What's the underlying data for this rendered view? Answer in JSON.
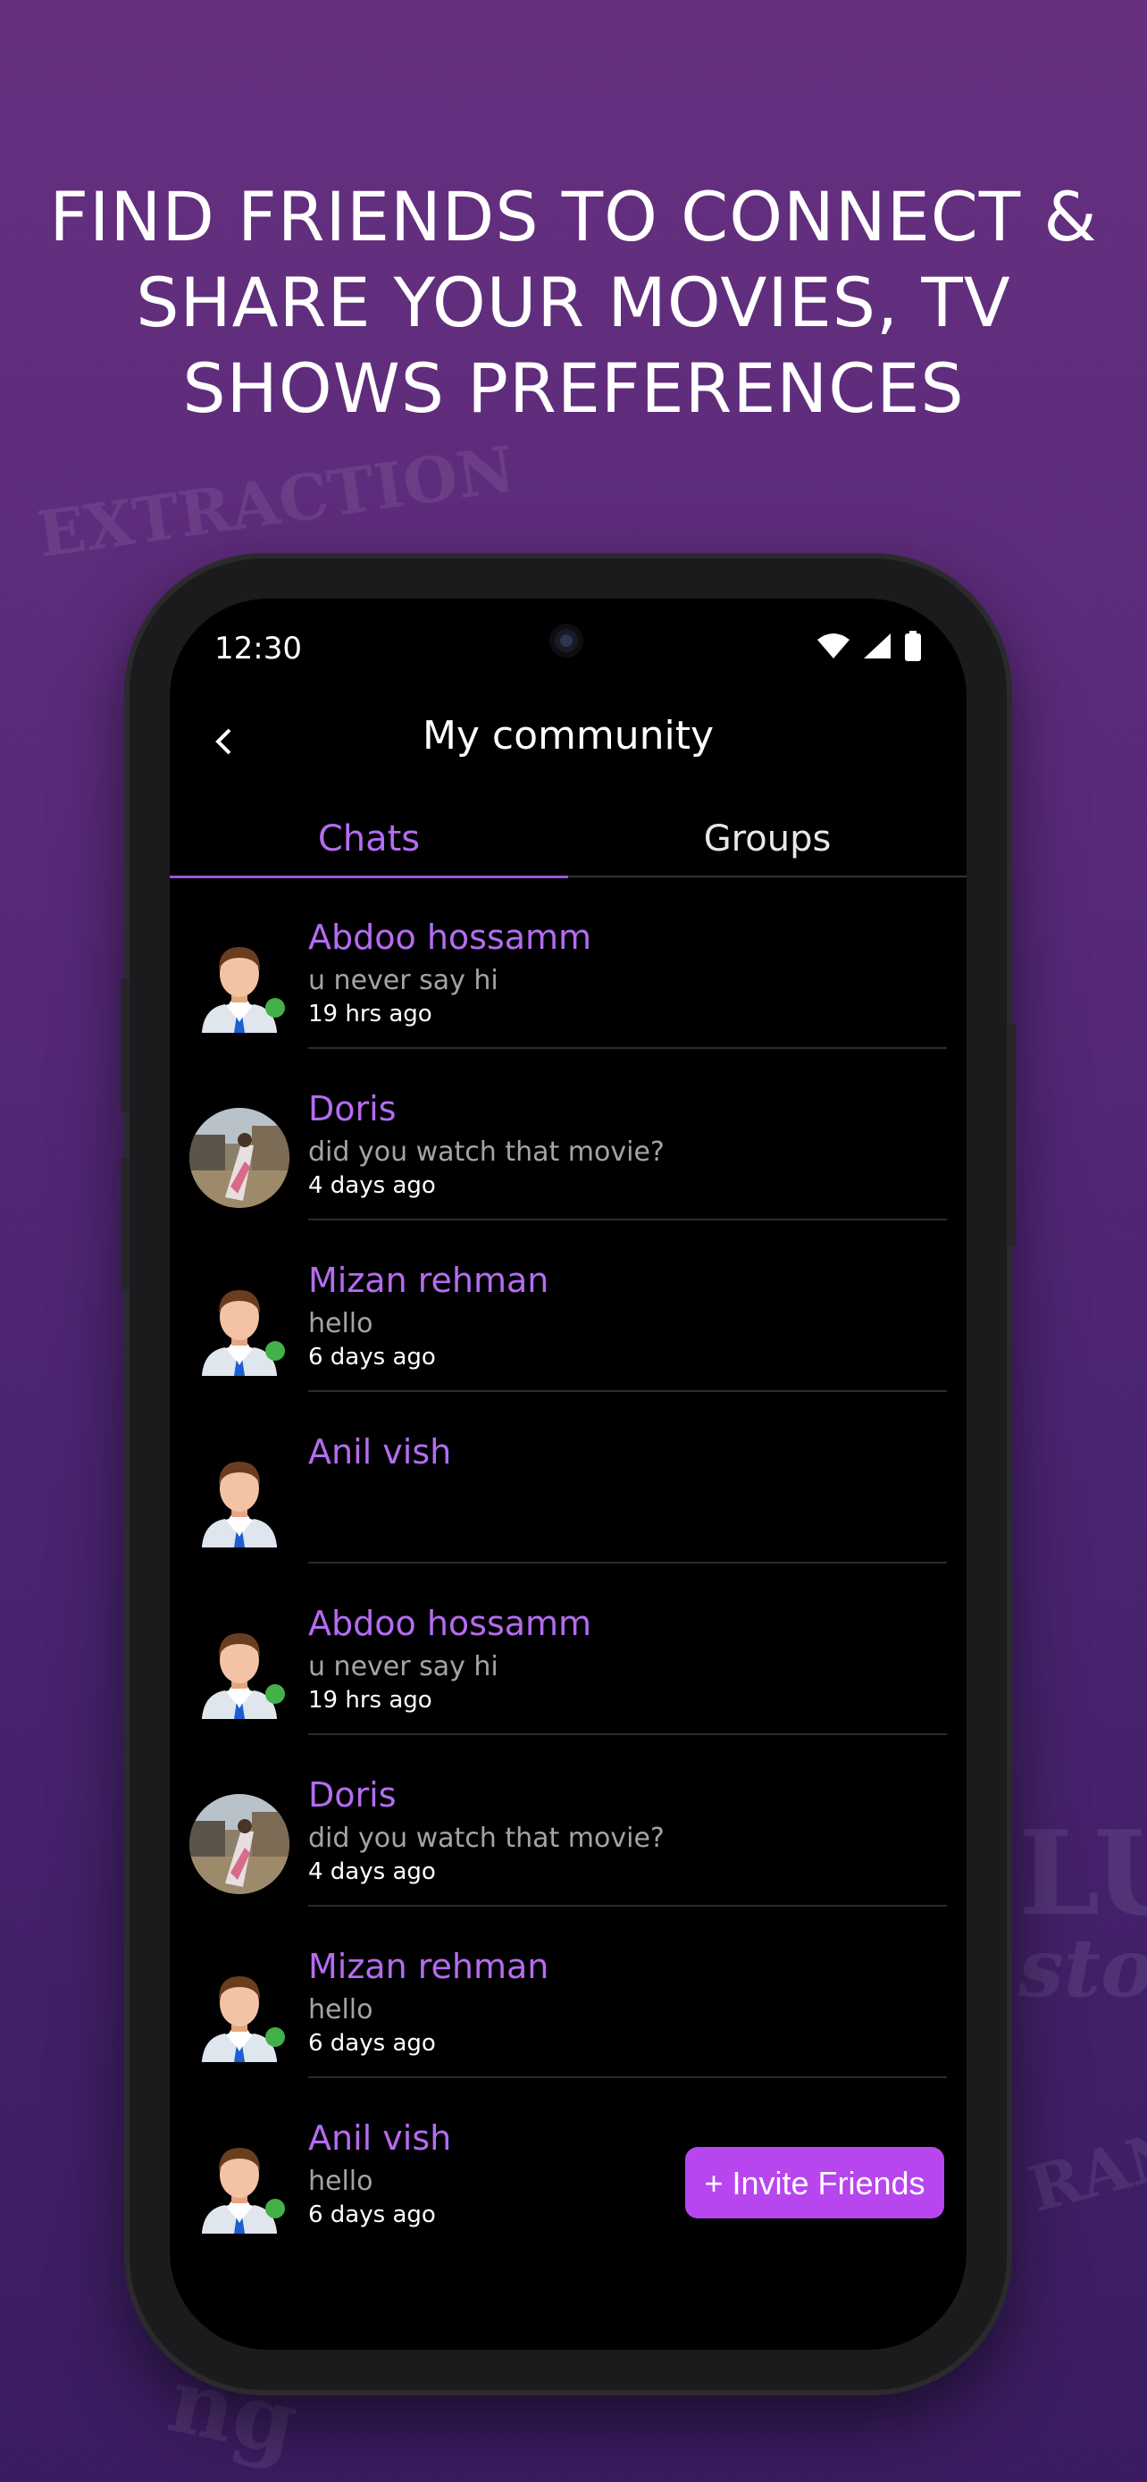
{
  "headline": {
    "line1": "FIND FRIENDS TO CONNECT &",
    "line2": "SHARE YOUR MOVIES, TV",
    "line3": "SHOWS PREFERENCES"
  },
  "background_posters": [
    "EXTRACTION",
    "LU",
    "stor",
    "RANG",
    "ng"
  ],
  "status_bar": {
    "time": "12:30",
    "icons": [
      "wifi-icon",
      "signal-icon",
      "battery-icon"
    ]
  },
  "header": {
    "title": "My community",
    "back_icon": "chevron-left-icon"
  },
  "tabs": [
    {
      "label": "Chats",
      "active": true
    },
    {
      "label": "Groups",
      "active": false
    }
  ],
  "chats": [
    {
      "name": "Abdoo hossamm",
      "message": "u never say hi",
      "time": "19 hrs ago",
      "avatar": "default-avatar",
      "online": true
    },
    {
      "name": "Doris",
      "message": "did you watch that movie?",
      "time": "4 days ago",
      "avatar": "photo",
      "online": false
    },
    {
      "name": "Mizan rehman",
      "message": "hello",
      "time": "6 days ago",
      "avatar": "default-avatar",
      "online": true
    },
    {
      "name": "Anil vish",
      "message": "",
      "time": "",
      "avatar": "default-avatar",
      "online": false
    },
    {
      "name": "Abdoo hossamm",
      "message": "u never say hi",
      "time": "19 hrs ago",
      "avatar": "default-avatar",
      "online": true
    },
    {
      "name": "Doris",
      "message": "did you watch that movie?",
      "time": "4 days ago",
      "avatar": "photo",
      "online": false
    },
    {
      "name": "Mizan rehman",
      "message": "hello",
      "time": "6 days ago",
      "avatar": "default-avatar",
      "online": true
    },
    {
      "name": "Anil vish",
      "message": "hello",
      "time": "6 days ago",
      "avatar": "default-avatar",
      "online": true
    }
  ],
  "invite_button": {
    "label": "+ Invite Friends"
  },
  "colors": {
    "accent": "#b46cf0",
    "button": "#b746ef",
    "online": "#43b048",
    "background": "#5a2a7a"
  }
}
